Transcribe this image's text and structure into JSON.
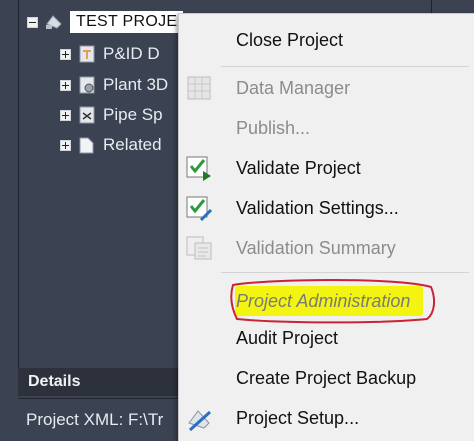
{
  "tree": {
    "root": {
      "label": "TEST PROJE"
    },
    "items": [
      {
        "label": "P&ID D",
        "icon": "pid-icon"
      },
      {
        "label": "Plant 3D",
        "icon": "plant3d-icon"
      },
      {
        "label": "Pipe Sp",
        "icon": "pipe-spec-icon"
      },
      {
        "label": "Related",
        "icon": "folder-icon"
      }
    ]
  },
  "details": {
    "header": "Details",
    "project_xml": "Project XML: F:\\Tr"
  },
  "context_menu": {
    "items": [
      {
        "label": "Close Project",
        "disabled": false
      },
      {
        "label": "Data Manager",
        "disabled": true,
        "icon": "data-manager-icon"
      },
      {
        "label": "Publish...",
        "disabled": true
      },
      {
        "label": "Validate Project",
        "disabled": false,
        "icon": "validate-project-icon"
      },
      {
        "label": "Validation Settings...",
        "disabled": false,
        "icon": "validation-settings-icon"
      },
      {
        "label": "Validation Summary",
        "disabled": true,
        "icon": "validation-summary-icon"
      },
      {
        "label": "Project Administration",
        "disabled": true,
        "highlighted": true
      },
      {
        "label": "Audit Project",
        "disabled": false
      },
      {
        "label": "Create Project Backup",
        "disabled": false
      },
      {
        "label": "Project Setup...",
        "disabled": false,
        "icon": "project-setup-icon"
      }
    ]
  },
  "colors": {
    "panel_bg": "#3b4252",
    "menu_bg": "#f0f0f0",
    "highlight": "#f3f511",
    "annotation_red": "#cc2233"
  }
}
